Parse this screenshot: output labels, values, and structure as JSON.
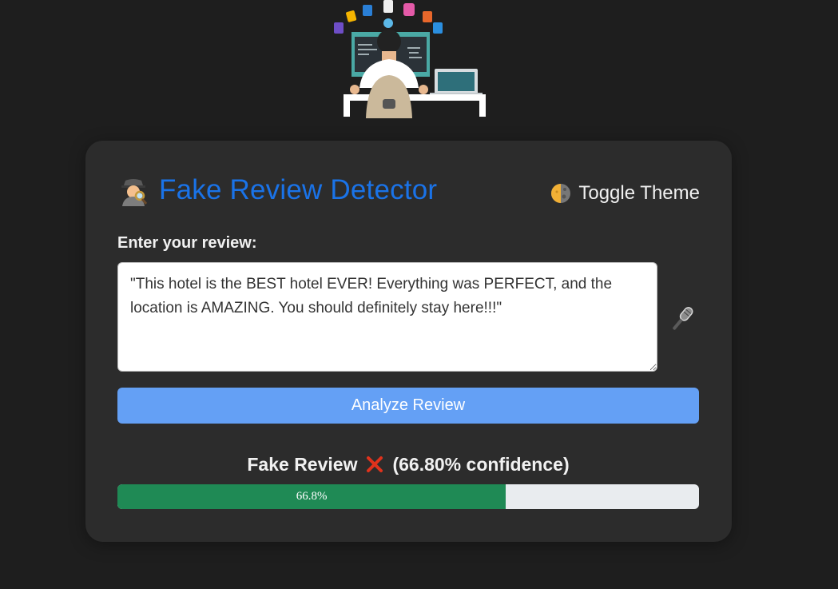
{
  "header": {
    "illustration": "developer-at-desk-illustration"
  },
  "card": {
    "title": "Fake Review Detector",
    "title_icon": "detective-icon",
    "title_color": "#1a73e8",
    "theme_toggle": {
      "label": "Toggle Theme",
      "icon": "moon-icon"
    },
    "input_label": "Enter your review:",
    "review_text": "\"This hotel is the BEST hotel EVER! Everything was PERFECT, and the location is AMAZING. You should definitely stay here!!!\"",
    "mic_icon": "microphone-icon",
    "analyze_button_label": "Analyze Review",
    "analyze_button_color": "#64a0f5",
    "result": {
      "verdict": "Fake Review",
      "verdict_icon": "x-icon",
      "confidence_text": "(66.80% confidence)",
      "progress_value": 0.668,
      "progress_label": "66.8%",
      "progress_color": "#1f8a55"
    }
  }
}
